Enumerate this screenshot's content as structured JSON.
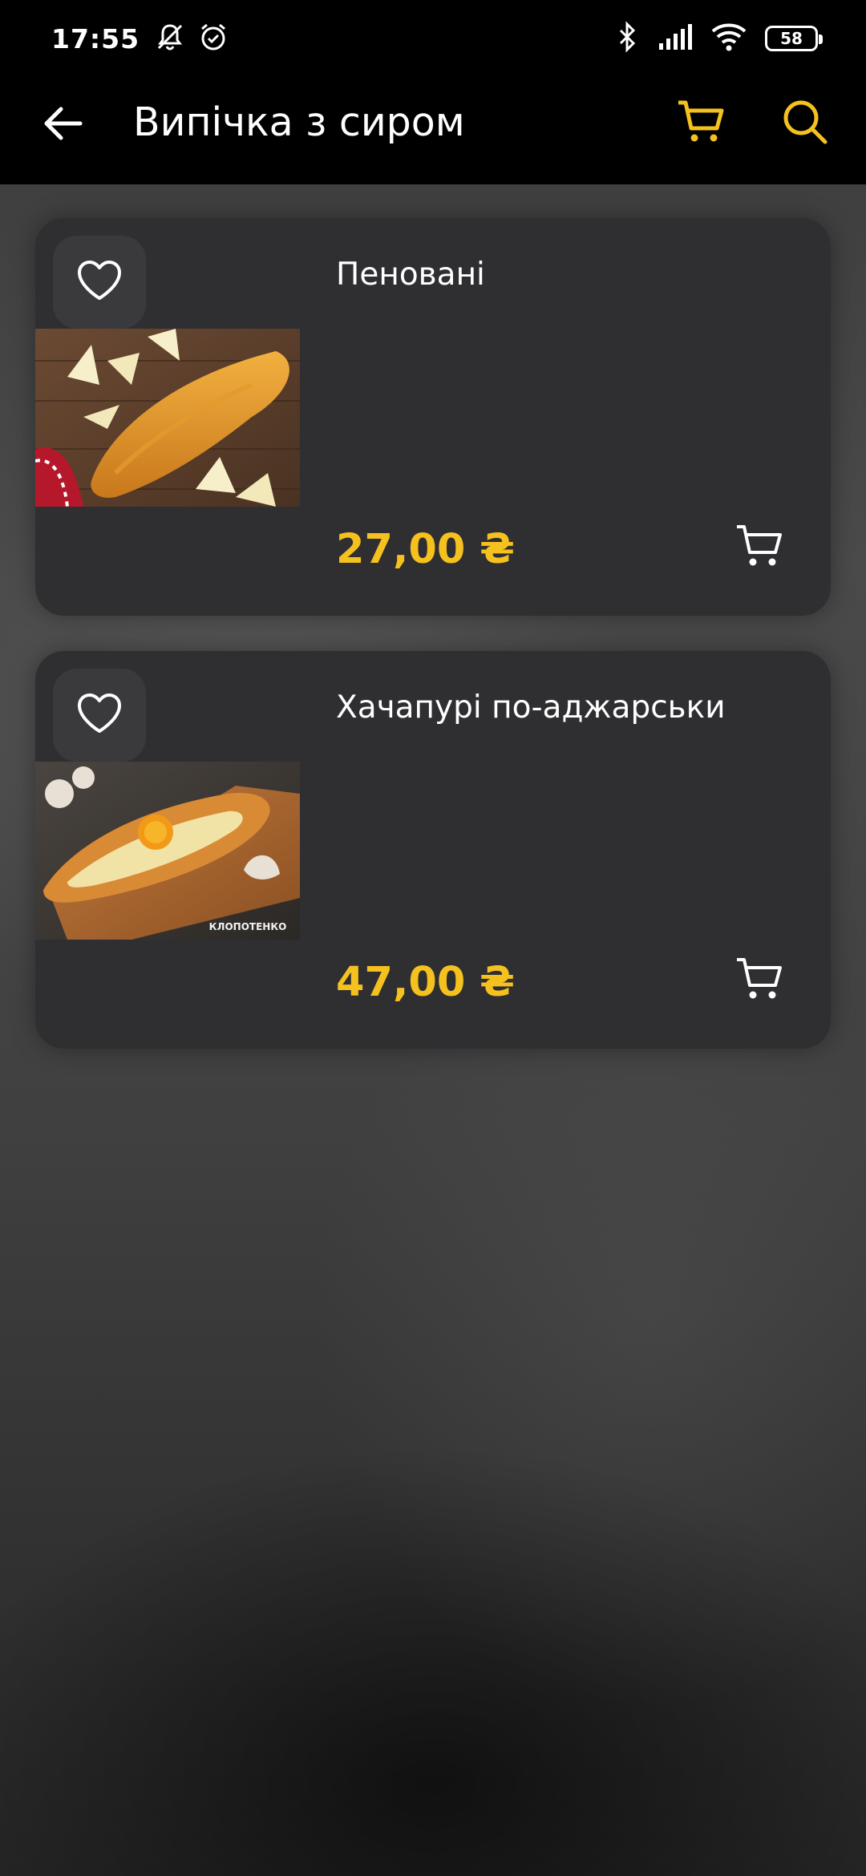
{
  "status_bar": {
    "time": "17:55",
    "battery": "58",
    "icons": [
      "mute-icon",
      "alarm-icon",
      "bluetooth-icon",
      "signal-icon",
      "wifi-icon",
      "battery-icon"
    ]
  },
  "app_bar": {
    "title": "Випічка з сиром",
    "icons": [
      "back-arrow-icon",
      "cart-icon",
      "search-icon"
    ],
    "accent_color": "#f4c11f"
  },
  "products": [
    {
      "name": "Пеновані",
      "price": "27,00 ₴"
    },
    {
      "name": "Хачапурі по-аджарськи",
      "price": "47,00 ₴",
      "image_watermark": "КЛОПОТЕНКО"
    }
  ],
  "colors": {
    "card_background": "#2f2e30",
    "price": "#f4c11f",
    "bar_background": "#000000"
  }
}
